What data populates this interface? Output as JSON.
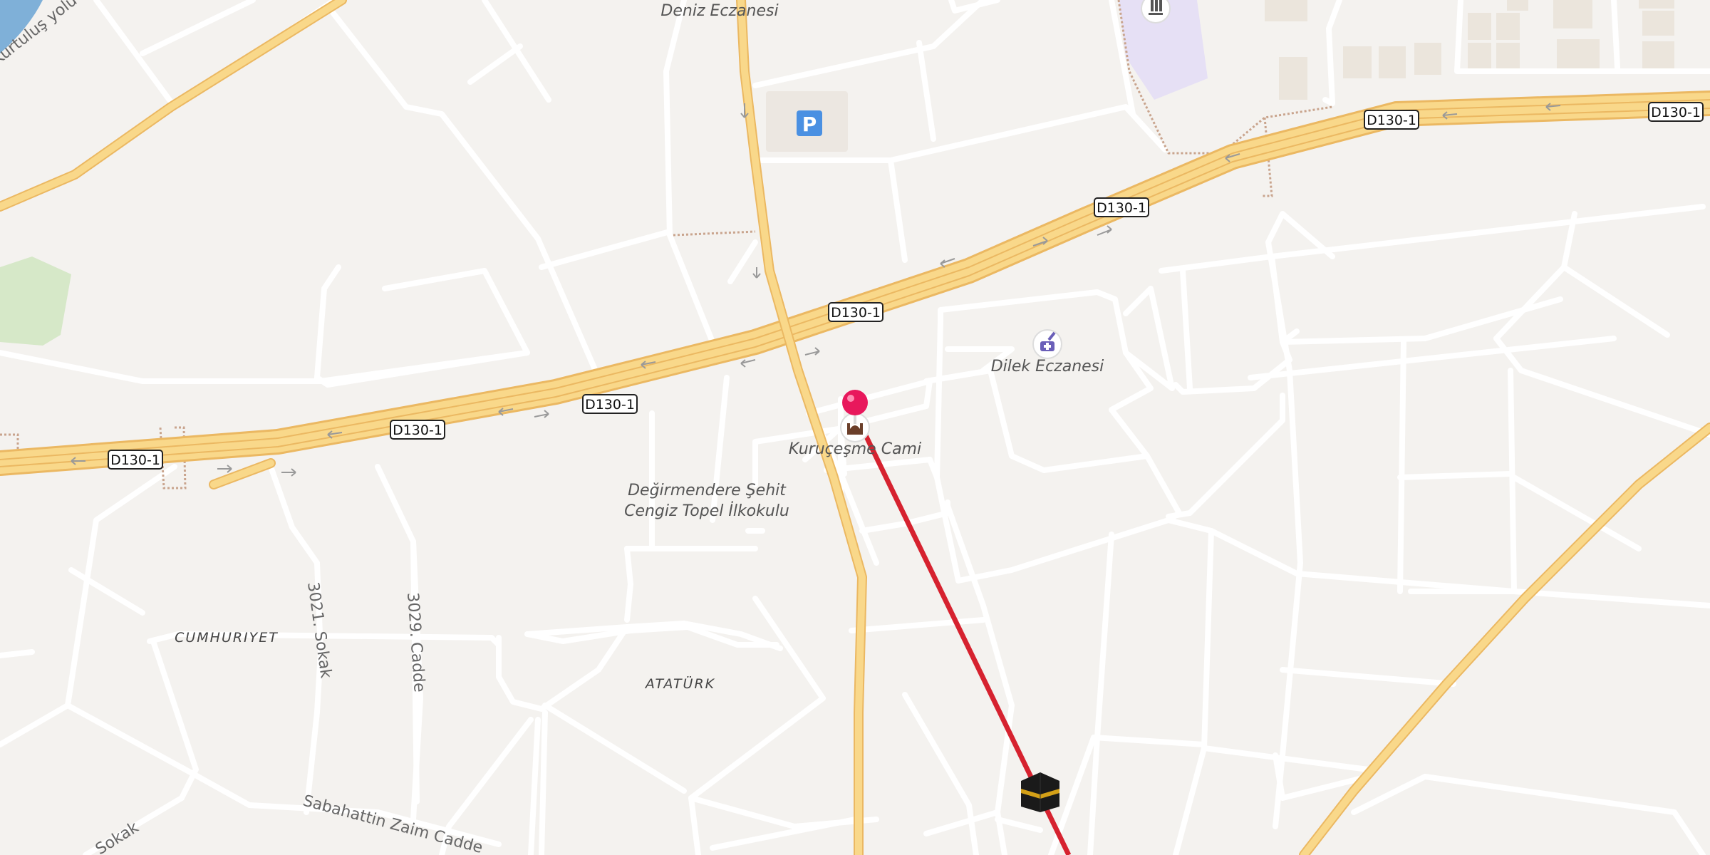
{
  "map": {
    "colors": {
      "background": "#f4f2ef",
      "road_minor": "#ffffff",
      "road_major_fill": "#f9d88a",
      "road_major_casing": "#ebb862",
      "water": "#7fb0d8",
      "park": "#d6e8c8",
      "route_line": "#d6222f",
      "pin": "#e8185c",
      "parking": "#4a90e2",
      "campus": "#e6e0f5"
    },
    "highway_shields": [
      {
        "label": "D130-1"
      },
      {
        "label": "D130-1"
      },
      {
        "label": "D130-1"
      },
      {
        "label": "D130-1"
      },
      {
        "label": "D130-1"
      },
      {
        "label": "D130-1"
      },
      {
        "label": "D130-1"
      }
    ],
    "pois": {
      "pharmacy_top": "Deniz Eczanesi",
      "pharmacy": "Dilek Eczanesi",
      "mosque": "Kuruçeşme Cami",
      "school_line1": "Değirmendere Şehit",
      "school_line2": "Cengiz Topel İlkokulu"
    },
    "districts": {
      "d1": "CUMHURIYET",
      "d2": "ATATÜRK"
    },
    "streets": {
      "s1": "3021. Sokak",
      "s2": "3029. Cadde",
      "s3": "Sabahattin Zaim Cadde",
      "s4": "Sokak",
      "s5": "Kurtuluş yolu"
    },
    "icons": {
      "parking": "P",
      "pin": "map-pin-icon",
      "kaaba": "kaaba-icon",
      "mosque": "mosque-icon",
      "pharmacy": "pharmacy-icon"
    }
  }
}
